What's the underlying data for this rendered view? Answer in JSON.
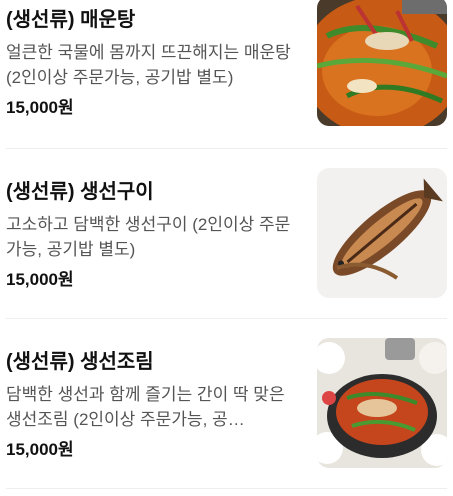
{
  "menu": {
    "items": [
      {
        "name": "(생선류) 매운탕",
        "description": "얼큰한 국물에 몸까지 뜨끈해지는 매운탕 (2인이상 주문가능, 공기밥 별도)",
        "price": "15,000원",
        "image_icon": "spicy-fish-stew-photo"
      },
      {
        "name": "(생선류) 생선구이",
        "description": "고소하고 담백한 생선구이 (2인이상 주문가능, 공기밥 별도)",
        "price": "15,000원",
        "image_icon": "grilled-fish-photo"
      },
      {
        "name": "(생선류) 생선조림",
        "description": "담백한 생선과 함께 즐기는 간이 딱 맞은 생선조림 (2인이상 주문가능, 공…",
        "price": "15,000원",
        "image_icon": "braised-fish-photo"
      }
    ]
  }
}
